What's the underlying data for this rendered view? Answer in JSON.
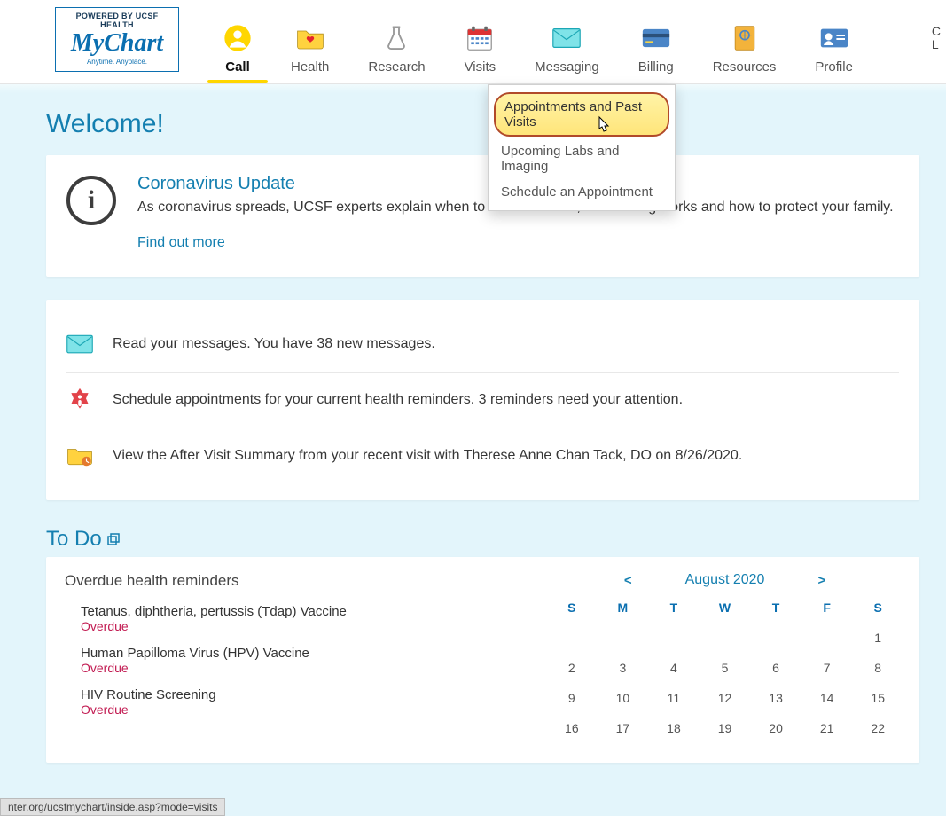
{
  "logo": {
    "powered": "POWERED BY UCSF HEALTH",
    "main": "MyChart",
    "tag": "Anytime. Anyplace."
  },
  "nav": {
    "call": "Call",
    "health": "Health",
    "research": "Research",
    "visits": "Visits",
    "messaging": "Messaging",
    "billing": "Billing",
    "resources": "Resources",
    "profile": "Profile"
  },
  "right_edge": {
    "line1": "C",
    "line2": "L"
  },
  "dropdown": {
    "item1": "Appointments and Past Visits",
    "item2": "Upcoming Labs and Imaging",
    "item3": "Schedule an Appointment"
  },
  "welcome_heading": "Welcome!",
  "info": {
    "title": "Coronavirus Update",
    "body": "As coronavirus spreads, UCSF experts explain when to call the doctor, how testing works and how to protect your family.",
    "link": "Find out more"
  },
  "alerts": {
    "messages": "Read your messages. You have 38 new messages.",
    "reminders": "Schedule appointments for your current health reminders. 3 reminders need your attention.",
    "avs": "View the After Visit Summary from your recent visit with Therese Anne Chan Tack, DO on 8/26/2020."
  },
  "todo_heading": "To Do",
  "reminders_heading": "Overdue health reminders",
  "rem": {
    "r1": "Tetanus, diphtheria, pertussis (Tdap) Vaccine",
    "r2": "Human Papilloma Virus (HPV) Vaccine",
    "r3": "HIV Routine Screening",
    "status": "Overdue"
  },
  "calendar": {
    "prev": "<",
    "next": ">",
    "title": "August 2020",
    "dow": {
      "s1": "S",
      "m": "M",
      "t1": "T",
      "w": "W",
      "t2": "T",
      "f": "F",
      "s2": "S"
    },
    "days": {
      "d1": "1",
      "d2": "2",
      "d3": "3",
      "d4": "4",
      "d5": "5",
      "d6": "6",
      "d7": "7",
      "d8": "8",
      "d9": "9",
      "d10": "10",
      "d11": "11",
      "d12": "12",
      "d13": "13",
      "d14": "14",
      "d15": "15",
      "d16": "16",
      "d17": "17",
      "d18": "18",
      "d19": "19",
      "d20": "20",
      "d21": "21",
      "d22": "22"
    }
  },
  "statusbar": "nter.org/ucsfmychart/inside.asp?mode=visits"
}
